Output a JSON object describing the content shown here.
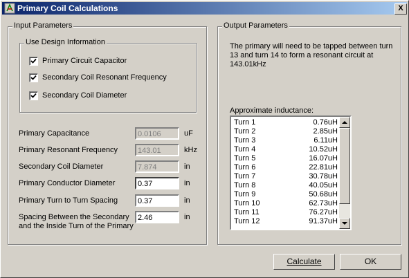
{
  "window": {
    "title": "Primary Coil Calculations",
    "close_label": "X"
  },
  "input_group": {
    "label": "Input Parameters"
  },
  "design_group": {
    "label": "Use Design Information",
    "checkboxes": [
      {
        "label": "Primary Circuit Capacitor",
        "checked": true
      },
      {
        "label": "Secondary Coil  Resonant Frequency",
        "checked": true
      },
      {
        "label": "Secondary Coil Diameter",
        "checked": true
      }
    ]
  },
  "fields": [
    {
      "label": "Primary Capacitance",
      "value": "0.0106",
      "unit": "uF",
      "disabled": true
    },
    {
      "label": "Primary Resonant Frequency",
      "value": "143.01",
      "unit": "kHz",
      "disabled": true
    },
    {
      "label": "Secondary Coil Diameter",
      "value": "7.874",
      "unit": "in",
      "disabled": true
    },
    {
      "label": "Primary Conductor Diameter",
      "value": "0.37",
      "unit": "in",
      "disabled": false
    },
    {
      "label": "Primary Turn to Turn Spacing",
      "value": "0.37",
      "unit": "in",
      "disabled": false
    },
    {
      "label_line1": "Spacing Between the Secondary",
      "label_line2": "and the Inside Turn of the Primary",
      "value": "2.46",
      "unit": "in",
      "disabled": false
    }
  ],
  "output_group": {
    "label": "Output Parameters",
    "message_line1": "The primary will need to be tapped between turn",
    "message_line2": "13 and turn 14 to form a resonant circuit at",
    "message_line3": "143.01kHz",
    "inductance_label": "Approximate inductance:",
    "inductance": [
      {
        "turn": "Turn  1",
        "value": "0.76uH"
      },
      {
        "turn": "Turn  2",
        "value": "2.85uH"
      },
      {
        "turn": "Turn  3",
        "value": "6.11uH"
      },
      {
        "turn": "Turn  4",
        "value": "10.52uH"
      },
      {
        "turn": "Turn  5",
        "value": "16.07uH"
      },
      {
        "turn": "Turn  6",
        "value": "22.81uH"
      },
      {
        "turn": "Turn  7",
        "value": "30.78uH"
      },
      {
        "turn": "Turn  8",
        "value": "40.05uH"
      },
      {
        "turn": "Turn  9",
        "value": "50.68uH"
      },
      {
        "turn": "Turn  10",
        "value": "62.73uH"
      },
      {
        "turn": "Turn  11",
        "value": "76.27uH"
      },
      {
        "turn": "Turn  12",
        "value": "91.37uH"
      }
    ]
  },
  "buttons": {
    "calculate": "Calculate",
    "ok": "OK"
  }
}
